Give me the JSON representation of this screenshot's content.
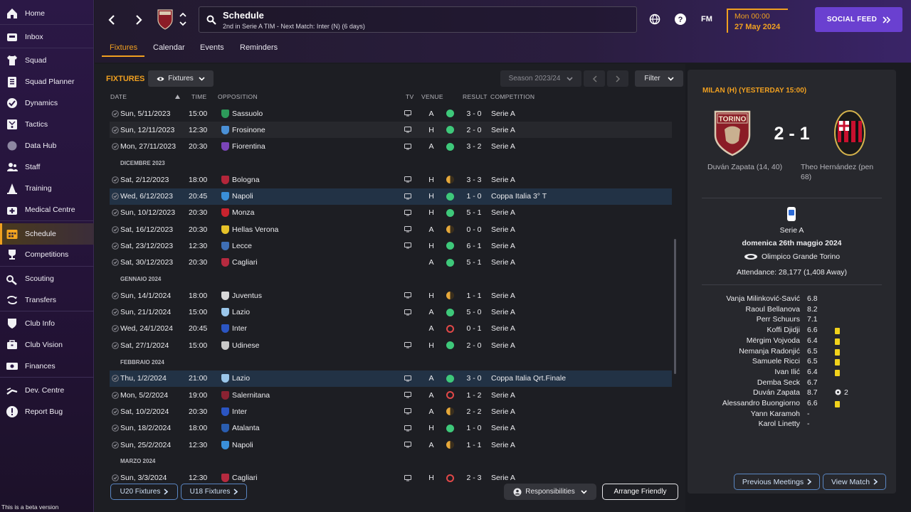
{
  "sidebar": {
    "items": [
      {
        "label": "Home",
        "icon": "home-icon"
      },
      {
        "label": "Inbox",
        "icon": "inbox-icon"
      },
      {
        "label": "Squad",
        "icon": "shirt-icon"
      },
      {
        "label": "Squad Planner",
        "icon": "clipboard-icon"
      },
      {
        "label": "Dynamics",
        "icon": "dynamics-icon"
      },
      {
        "label": "Tactics",
        "icon": "tactics-board-icon"
      },
      {
        "label": "Data Hub",
        "icon": "data-hub-icon"
      },
      {
        "label": "Staff",
        "icon": "staff-icon"
      },
      {
        "label": "Training",
        "icon": "training-cone-icon"
      },
      {
        "label": "Medical Centre",
        "icon": "medical-icon"
      },
      {
        "label": "Schedule",
        "icon": "calendar-icon",
        "active": true
      },
      {
        "label": "Competitions",
        "icon": "trophy-icon"
      },
      {
        "label": "Scouting",
        "icon": "binoculars-icon"
      },
      {
        "label": "Transfers",
        "icon": "transfer-arrows-icon"
      },
      {
        "label": "Club Info",
        "icon": "shield-icon"
      },
      {
        "label": "Club Vision",
        "icon": "briefcase-icon"
      },
      {
        "label": "Finances",
        "icon": "money-icon"
      },
      {
        "label": "Dev. Centre",
        "icon": "dev-centre-icon"
      },
      {
        "label": "Report Bug",
        "icon": "report-bug-icon"
      }
    ],
    "beta_label": "This is a beta version"
  },
  "header": {
    "title": "Schedule",
    "subtitle": "2nd in Serie A TIM - Next Match: Inter (N) (6 days)",
    "fm_label": "FM",
    "time": "Mon 00:00",
    "date": "27 May 2024",
    "social_feed": "SOCIAL FEED",
    "tabs": [
      "Fixtures",
      "Calendar",
      "Events",
      "Reminders"
    ]
  },
  "fixtures": {
    "title": "FIXTURES",
    "filter_label": "Fixtures",
    "season": "Season 2023/24",
    "filter_button": "Filter",
    "columns": {
      "date": "DATE",
      "time": "TIME",
      "opposition": "OPPOSITION",
      "tv": "TV",
      "venue": "VENUE",
      "result": "RESULT",
      "competition": "COMPETITION"
    },
    "rows": [
      {
        "type": "match",
        "date": "Sun, 5/11/2023",
        "time": "15:00",
        "opp": "Sassuolo",
        "crest": "#2d9b5a",
        "tv": true,
        "venue": "A",
        "outcome": "w",
        "result": "3 - 0",
        "comp": "Serie A"
      },
      {
        "type": "match",
        "date": "Sun, 12/11/2023",
        "time": "12:30",
        "opp": "Frosinone",
        "crest": "#4a90d6",
        "tv": true,
        "venue": "H",
        "outcome": "w",
        "result": "2 - 0",
        "comp": "Serie A"
      },
      {
        "type": "match",
        "date": "Mon, 27/11/2023",
        "time": "20:30",
        "opp": "Fiorentina",
        "crest": "#7b45b8",
        "tv": true,
        "venue": "A",
        "outcome": "w",
        "result": "3 - 2",
        "comp": "Serie A"
      },
      {
        "type": "month",
        "label": "DICEMBRE 2023"
      },
      {
        "type": "match",
        "date": "Sat, 2/12/2023",
        "time": "18:00",
        "opp": "Bologna",
        "crest": "#b3263a",
        "tv": true,
        "venue": "H",
        "outcome": "d",
        "result": "3 - 3",
        "comp": "Serie A"
      },
      {
        "type": "match",
        "date": "Wed, 6/12/2023",
        "time": "20:45",
        "opp": "Napoli",
        "crest": "#3a8fd9",
        "tv": true,
        "venue": "H",
        "outcome": "w",
        "result": "1 - 0",
        "comp": "Coppa Italia 3° T",
        "highlight": true
      },
      {
        "type": "match",
        "date": "Sun, 10/12/2023",
        "time": "20:30",
        "opp": "Monza",
        "crest": "#c8232e",
        "tv": true,
        "venue": "H",
        "outcome": "w",
        "result": "5 - 1",
        "comp": "Serie A"
      },
      {
        "type": "match",
        "date": "Sat, 16/12/2023",
        "time": "20:30",
        "opp": "Hellas Verona",
        "crest": "#e6c229",
        "tv": true,
        "venue": "A",
        "outcome": "d",
        "result": "0 - 0",
        "comp": "Serie A"
      },
      {
        "type": "match",
        "date": "Sat, 23/12/2023",
        "time": "12:30",
        "opp": "Lecce",
        "crest": "#3f6fb5",
        "tv": true,
        "venue": "H",
        "outcome": "w",
        "result": "6 - 1",
        "comp": "Serie A"
      },
      {
        "type": "match",
        "date": "Sat, 30/12/2023",
        "time": "20:30",
        "opp": "Cagliari",
        "crest": "#b52a3f",
        "tv": false,
        "venue": "A",
        "outcome": "w",
        "result": "5 - 1",
        "comp": "Serie A"
      },
      {
        "type": "month",
        "label": "GENNAIO 2024"
      },
      {
        "type": "match",
        "date": "Sun, 14/1/2024",
        "time": "18:00",
        "opp": "Juventus",
        "crest": "#d8d8d8",
        "tv": true,
        "venue": "H",
        "outcome": "d",
        "result": "1 - 1",
        "comp": "Serie A"
      },
      {
        "type": "match",
        "date": "Sun, 21/1/2024",
        "time": "15:00",
        "opp": "Lazio",
        "crest": "#9ac6ea",
        "tv": true,
        "venue": "A",
        "outcome": "w",
        "result": "5 - 0",
        "comp": "Serie A"
      },
      {
        "type": "match",
        "date": "Wed, 24/1/2024",
        "time": "20:45",
        "opp": "Inter",
        "crest": "#2b55c2",
        "tv": false,
        "venue": "A",
        "outcome": "l",
        "result": "0 - 1",
        "comp": "Serie A"
      },
      {
        "type": "match",
        "date": "Sat, 27/1/2024",
        "time": "15:00",
        "opp": "Udinese",
        "crest": "#c9c9c9",
        "tv": true,
        "venue": "H",
        "outcome": "w",
        "result": "2 - 0",
        "comp": "Serie A"
      },
      {
        "type": "month",
        "label": "FEBBRAIO 2024"
      },
      {
        "type": "match",
        "date": "Thu, 1/2/2024",
        "time": "21:00",
        "opp": "Lazio",
        "crest": "#9ac6ea",
        "tv": true,
        "venue": "A",
        "outcome": "w",
        "result": "3 - 0",
        "comp": "Coppa Italia Qrt.Finale",
        "highlight": true
      },
      {
        "type": "match",
        "date": "Mon, 5/2/2024",
        "time": "19:00",
        "opp": "Salernitana",
        "crest": "#8b2232",
        "tv": true,
        "venue": "A",
        "outcome": "l",
        "result": "1 - 2",
        "comp": "Serie A"
      },
      {
        "type": "match",
        "date": "Sat, 10/2/2024",
        "time": "20:30",
        "opp": "Inter",
        "crest": "#2b55c2",
        "tv": true,
        "venue": "A",
        "outcome": "d",
        "result": "2 - 2",
        "comp": "Serie A"
      },
      {
        "type": "match",
        "date": "Sun, 18/2/2024",
        "time": "18:00",
        "opp": "Atalanta",
        "crest": "#2a5db0",
        "tv": true,
        "venue": "H",
        "outcome": "w",
        "result": "1 - 0",
        "comp": "Serie A"
      },
      {
        "type": "match",
        "date": "Sun, 25/2/2024",
        "time": "12:30",
        "opp": "Napoli",
        "crest": "#3a8fd9",
        "tv": true,
        "venue": "A",
        "outcome": "d",
        "result": "1 - 1",
        "comp": "Serie A"
      },
      {
        "type": "month",
        "label": "MARZO 2024"
      },
      {
        "type": "match",
        "date": "Sun, 3/3/2024",
        "time": "12:30",
        "opp": "Cagliari",
        "crest": "#b52a3f",
        "tv": true,
        "venue": "H",
        "outcome": "l",
        "result": "2 - 3",
        "comp": "Serie A"
      }
    ],
    "u20_button": "U20 Fixtures",
    "u18_button": "U18 Fixtures",
    "responsibilities_button": "Responsibilities",
    "arrange_friendly_button": "Arrange Friendly"
  },
  "match": {
    "title": "MILAN (H) (YESTERDAY 15:00)",
    "home_crest_text": "TORINO",
    "score": "2 - 1",
    "home_scorers": "Duván Zapata (14, 40)",
    "away_scorers": "Theo Hernández (pen 68)",
    "competition": "Serie A",
    "date": "domenica 26th maggio 2024",
    "stadium": "Olimpico Grande Torino",
    "attendance": "Attendance: 28,177 (1,408 Away)",
    "players": [
      {
        "name": "Vanja Milinković-Savić",
        "rating": "6.8",
        "card": false
      },
      {
        "name": "Raoul Bellanova",
        "rating": "8.2",
        "card": false
      },
      {
        "name": "Perr Schuurs",
        "rating": "7.1",
        "card": false
      },
      {
        "name": "Koffi Djidji",
        "rating": "6.6",
        "card": true
      },
      {
        "name": "Mërgim Vojvoda",
        "rating": "6.4",
        "card": true
      },
      {
        "name": "Nemanja Radonjić",
        "rating": "6.5",
        "card": true
      },
      {
        "name": "Samuele Ricci",
        "rating": "6.5",
        "card": true
      },
      {
        "name": "Ivan Ilić",
        "rating": "6.4",
        "card": true
      },
      {
        "name": "Demba Seck",
        "rating": "6.7",
        "card": false
      },
      {
        "name": "Duván Zapata",
        "rating": "8.7",
        "card": false,
        "goals": "2"
      },
      {
        "name": "Alessandro Buongiorno",
        "rating": "6.6",
        "card": true
      },
      {
        "name": "Yann Karamoh",
        "rating": "-",
        "card": false
      },
      {
        "name": "Karol Linetty",
        "rating": "-",
        "card": false
      }
    ],
    "previous_meetings_button": "Previous Meetings",
    "view_match_button": "View Match"
  },
  "colors": {
    "accent": "#f0a020",
    "win": "#3ec87a",
    "draw": "#e6a83a",
    "loss": "#e24848",
    "social": "#6a40d0"
  }
}
